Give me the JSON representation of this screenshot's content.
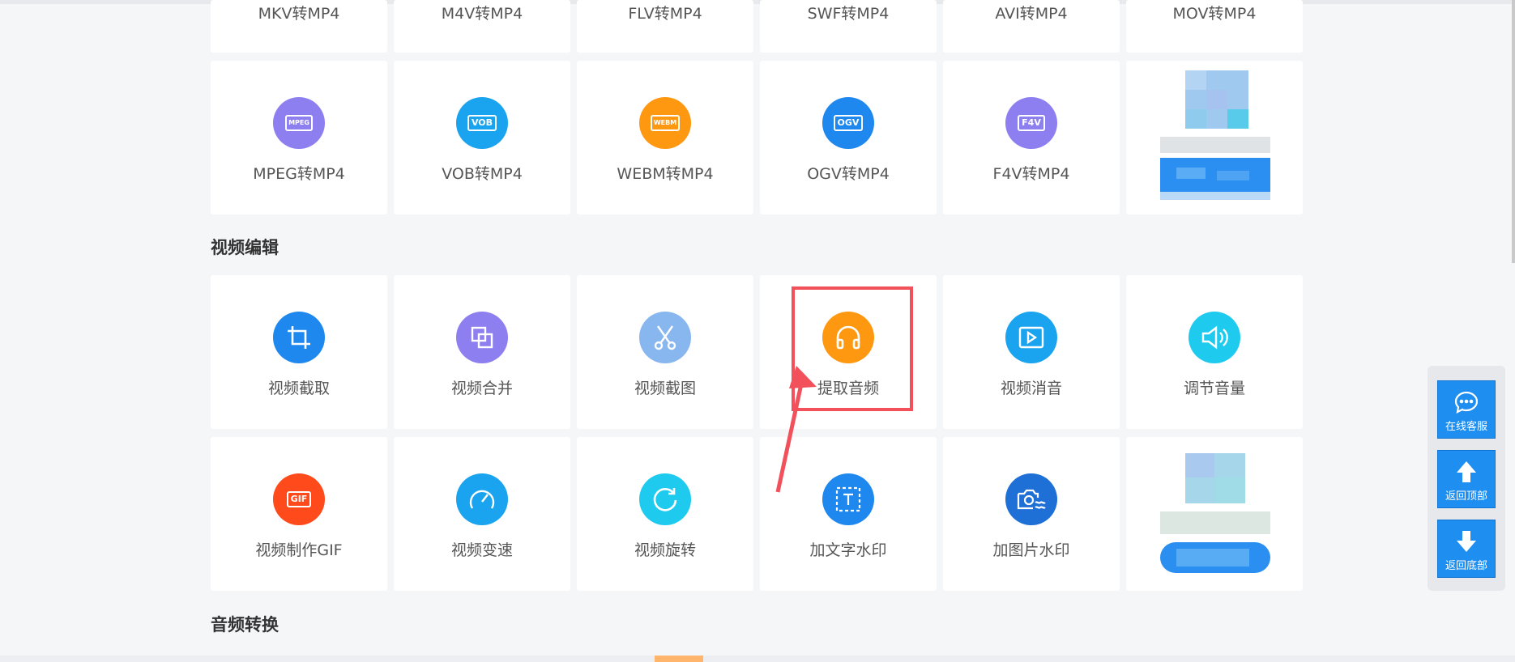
{
  "sections": {
    "video_edit": "视频编辑",
    "audio_convert": "音频转换"
  },
  "row_top": [
    {
      "label": "MKV转MP4"
    },
    {
      "label": "M4V转MP4"
    },
    {
      "label": "FLV转MP4"
    },
    {
      "label": "SWF转MP4"
    },
    {
      "label": "AVI转MP4"
    },
    {
      "label": "MOV转MP4"
    }
  ],
  "row_formats": [
    {
      "label": "MPEG转MP4",
      "badge": "MPEG",
      "color": "#8d7ff0",
      "icon": "mpeg-file-icon"
    },
    {
      "label": "VOB转MP4",
      "badge": "VOB",
      "color": "#1aa3ee",
      "icon": "vob-file-icon"
    },
    {
      "label": "WEBM转MP4",
      "badge": "WEBM",
      "color": "#ff9811",
      "icon": "webm-file-icon"
    },
    {
      "label": "OGV转MP4",
      "badge": "OGV",
      "color": "#1e88ef",
      "icon": "ogv-file-icon"
    },
    {
      "label": "F4V转MP4",
      "badge": "F4V",
      "color": "#8d7ff0",
      "icon": "f4v-file-icon"
    }
  ],
  "row_edit1": [
    {
      "label": "视频截取",
      "color": "#1e88ef",
      "icon": "crop-icon"
    },
    {
      "label": "视频合并",
      "color": "#8d7ff0",
      "icon": "merge-icon"
    },
    {
      "label": "视频截图",
      "color": "#88b7f0",
      "icon": "scissors-icon"
    },
    {
      "label": "提取音频",
      "color": "#ff9811",
      "icon": "headphones-icon"
    },
    {
      "label": "视频消音",
      "color": "#1aa3ee",
      "icon": "play-icon"
    },
    {
      "label": "调节音量",
      "color": "#1ecbee",
      "icon": "speaker-icon"
    }
  ],
  "row_edit2": [
    {
      "label": "视频制作GIF",
      "badge": "GIF",
      "color": "#ff4a1c",
      "icon": "gif-icon"
    },
    {
      "label": "视频变速",
      "color": "#1aa3ee",
      "icon": "speedometer-icon"
    },
    {
      "label": "视频旋转",
      "color": "#1ecbee",
      "icon": "rotate-icon"
    },
    {
      "label": "加文字水印",
      "color": "#1e88ef",
      "icon": "text-watermark-icon"
    },
    {
      "label": "加图片水印",
      "color": "#1e6fd6",
      "icon": "image-watermark-icon"
    }
  ],
  "sidebar": {
    "online_service": "在线客服",
    "back_top": "返回顶部",
    "back_bottom": "返回底部"
  }
}
